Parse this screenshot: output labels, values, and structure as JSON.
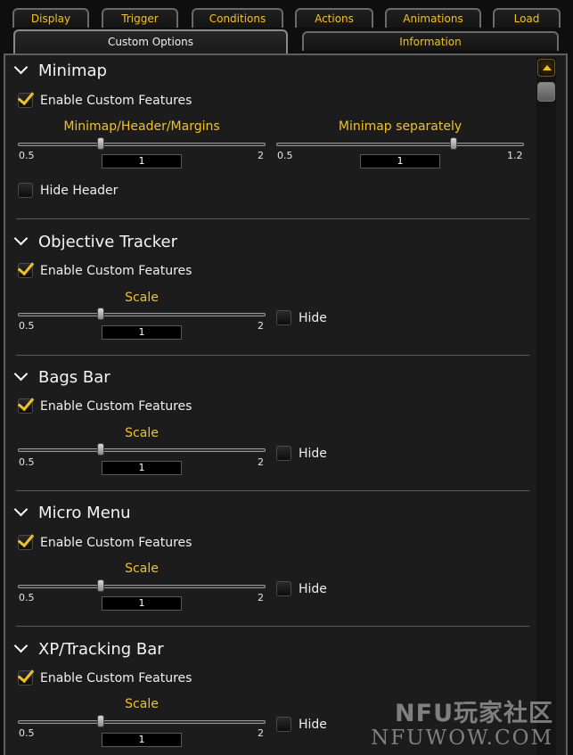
{
  "tabs_row1": [
    {
      "label": "Display",
      "active": false
    },
    {
      "label": "Trigger",
      "active": false
    },
    {
      "label": "Conditions",
      "active": false
    },
    {
      "label": "Actions",
      "active": false
    },
    {
      "label": "Animations",
      "active": false
    },
    {
      "label": "Load",
      "active": false
    }
  ],
  "tabs_row2": [
    {
      "label": "Custom Options",
      "active": true
    },
    {
      "label": "Information",
      "active": false
    }
  ],
  "sections": [
    {
      "title": "Minimap",
      "enable_label": "Enable Custom Features",
      "enable_checked": true,
      "sliders": [
        {
          "label": "Minimap/Header/Margins",
          "min": "0.5",
          "max": "2",
          "value": "1",
          "fraction": 0.3333
        },
        {
          "label": "Minimap separately",
          "min": "0.5",
          "max": "1.2",
          "value": "1",
          "fraction": 0.7143
        }
      ],
      "extra_checkbox": {
        "label": "Hide Header",
        "checked": false
      }
    },
    {
      "title": "Objective Tracker",
      "enable_label": "Enable Custom Features",
      "enable_checked": true,
      "sliders": [
        {
          "label": "Scale",
          "min": "0.5",
          "max": "2",
          "value": "1",
          "fraction": 0.3333
        }
      ],
      "hide": {
        "label": "Hide",
        "checked": false
      }
    },
    {
      "title": "Bags Bar",
      "enable_label": "Enable Custom Features",
      "enable_checked": true,
      "sliders": [
        {
          "label": "Scale",
          "min": "0.5",
          "max": "2",
          "value": "1",
          "fraction": 0.3333
        }
      ],
      "hide": {
        "label": "Hide",
        "checked": false
      }
    },
    {
      "title": "Micro Menu",
      "enable_label": "Enable Custom Features",
      "enable_checked": true,
      "sliders": [
        {
          "label": "Scale",
          "min": "0.5",
          "max": "2",
          "value": "1",
          "fraction": 0.3333
        }
      ],
      "hide": {
        "label": "Hide",
        "checked": false
      }
    },
    {
      "title": "XP/Tracking Bar",
      "enable_label": "Enable Custom Features",
      "enable_checked": true,
      "sliders": [
        {
          "label": "Scale",
          "min": "0.5",
          "max": "2",
          "value": "1",
          "fraction": 0.3333
        }
      ],
      "hide": {
        "label": "Hide",
        "checked": false
      }
    }
  ],
  "watermark": {
    "line1": "NFU玩家社区",
    "line2": "NFUWOW.COM"
  },
  "colors": {
    "accent": "#f2c21f",
    "panel_bg": "#1c1c1c",
    "page_bg": "#0e0e0e"
  },
  "icons": {
    "section_toggle": "chevron-down-icon",
    "check": "checkmark-icon",
    "scroll_up": "arrow-up-icon"
  }
}
